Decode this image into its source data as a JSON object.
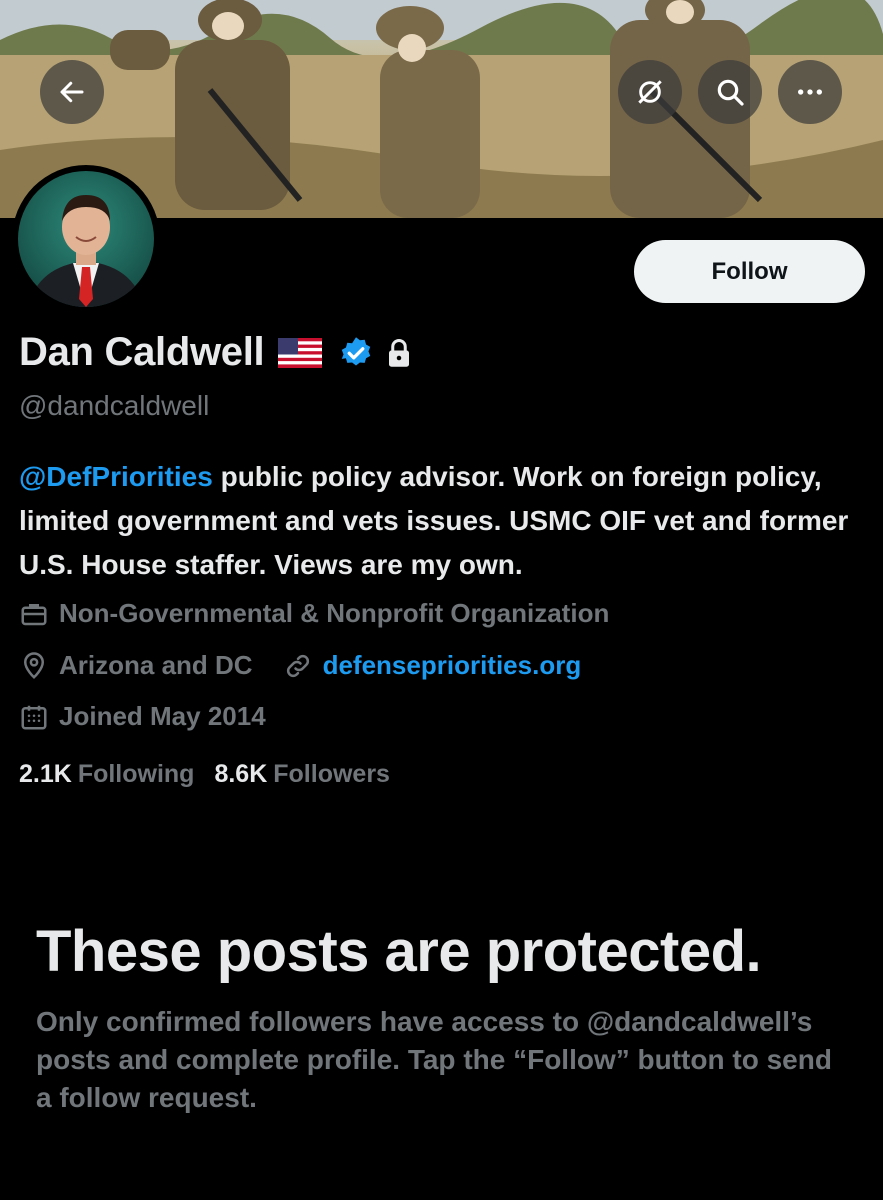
{
  "header": {
    "back_icon": "arrow-left-icon",
    "share_icon": "share-slash-icon",
    "search_icon": "search-icon",
    "more_icon": "ellipsis-icon"
  },
  "profile": {
    "name": "Dan Caldwell",
    "flag_icon": "us-flag-icon",
    "verified_icon": "verified-badge-icon",
    "lock_icon": "lock-icon",
    "handle": "@dandcaldwell",
    "follow_label": "Follow",
    "bio_mention": "@DefPriorities",
    "bio_text": " public policy advisor. Work on foreign policy, limited government and vets issues. USMC OIF vet and former U.S. House staffer. Views are my own.",
    "category": "Non-Governmental & Nonprofit Organization",
    "location": "Arizona and DC",
    "website": "defensepriorities.org",
    "joined": "Joined May 2014",
    "following_count": "2.1K",
    "following_label": "Following",
    "followers_count": "8.6K",
    "followers_label": "Followers"
  },
  "protected": {
    "title": "These posts are protected.",
    "body": "Only confirmed followers have access to @dandcaldwell’s posts and complete profile. Tap the “Follow” button to send a follow request."
  },
  "colors": {
    "accent": "#1d9bf0",
    "muted": "#71767b",
    "text": "#e7e9ea",
    "background": "#000000"
  }
}
